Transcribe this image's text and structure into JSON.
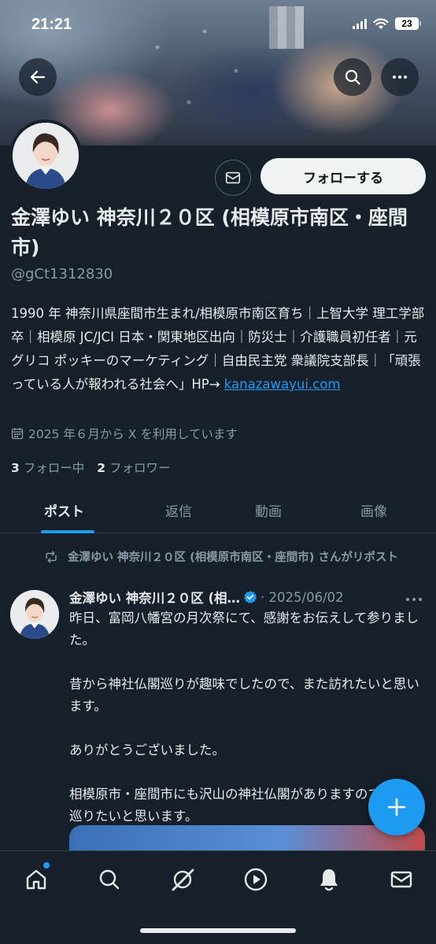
{
  "status_bar": {
    "time": "21:21",
    "battery": "23"
  },
  "header": {
    "back_icon": "arrow-left-icon",
    "search_icon": "search-icon",
    "more_icon": "more-horizontal-icon"
  },
  "profile": {
    "name": "金澤ゆい 神奈川２０区 (相模原市南区・座間市)",
    "handle": "@gCt1312830",
    "follow_label": "フォローする",
    "bio_text": "1990 年 神奈川県座間市生まれ/相模原市南区育ち｜上智大学 理工学部卒｜相模原 JC/JCI 日本・関東地区出向｜防災士｜介護職員初任者｜元グリコ ポッキーのマーケティング｜自由民主党 衆議院支部長｜「頑張っている人が報われる社会へ」HP→ ",
    "bio_link": "kanazawayui.com",
    "joined": "2025 年６月から X を利用しています",
    "following_count": "3",
    "following_label": "フォロー中",
    "followers_count": "2",
    "followers_label": "フォロワー"
  },
  "tabs": [
    {
      "label": "ポスト",
      "active": true
    },
    {
      "label": "返信",
      "active": false
    },
    {
      "label": "動画",
      "active": false
    },
    {
      "label": "画像",
      "active": false
    }
  ],
  "post": {
    "repost_text": "金澤ゆい 神奈川２０区 (相模原市南区・座間市) さんがリポスト",
    "author": "金澤ゆい 神奈川２０区 (相…",
    "date": "· 2025/06/02",
    "body": "昨日、富岡八幡宮の月次祭にて、感謝をお伝えして参りました。\n\n昔から神社仏閣巡りが趣味でしたので、また訪れたいと思います。\n\nありがとうございました。\n\n相模原市・座間市にも沢山の神社仏閣がありますので、また巡りたいと思います。"
  },
  "colors": {
    "background": "#15202b",
    "accent": "#1d9bf0",
    "muted": "#8b98a5",
    "text": "#e7e9ea"
  },
  "bottom_nav": [
    "home-icon",
    "search-icon",
    "grok-icon",
    "video-icon",
    "bell-icon",
    "mail-icon"
  ]
}
